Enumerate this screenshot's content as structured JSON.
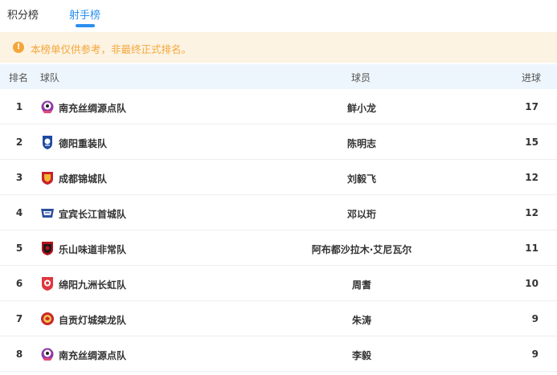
{
  "tabs": [
    {
      "label": "积分榜",
      "active": false
    },
    {
      "label": "射手榜",
      "active": true
    }
  ],
  "notice": {
    "icon": "warning-icon",
    "text": "本榜单仅供参考，非最终正式排名。"
  },
  "table": {
    "headers": {
      "rank": "排名",
      "team": "球队",
      "player": "球员",
      "goals": "进球"
    },
    "rows": [
      {
        "rank": "1",
        "team": "南充丝绸源点队",
        "badge": "nanchong-badge-icon",
        "player": "鲜小龙",
        "goals": "17"
      },
      {
        "rank": "2",
        "team": "德阳重装队",
        "badge": "deyang-badge-icon",
        "player": "陈明志",
        "goals": "15"
      },
      {
        "rank": "3",
        "team": "成都锦城队",
        "badge": "chengdu-badge-icon",
        "player": "刘毅飞",
        "goals": "12"
      },
      {
        "rank": "4",
        "team": "宜宾长江首城队",
        "badge": "yibin-badge-icon",
        "player": "邓以珩",
        "goals": "12"
      },
      {
        "rank": "5",
        "team": "乐山味道非常队",
        "badge": "leshan-badge-icon",
        "player": "阿布都沙拉木·艾尼瓦尔",
        "goals": "11"
      },
      {
        "rank": "6",
        "team": "绵阳九洲长虹队",
        "badge": "mianyang-badge-icon",
        "player": "周耆",
        "goals": "10"
      },
      {
        "rank": "7",
        "team": "自贡灯城桀龙队",
        "badge": "zigong-badge-icon",
        "player": "朱涛",
        "goals": "9"
      },
      {
        "rank": "8",
        "team": "南充丝绸源点队",
        "badge": "nanchong-badge-icon",
        "player": "李毅",
        "goals": "9"
      }
    ]
  },
  "colors": {
    "accent": "#2b8ff0",
    "notice_bg": "#fdf3e2",
    "notice_text": "#f3a63b",
    "header_bg": "#eef6fd"
  }
}
